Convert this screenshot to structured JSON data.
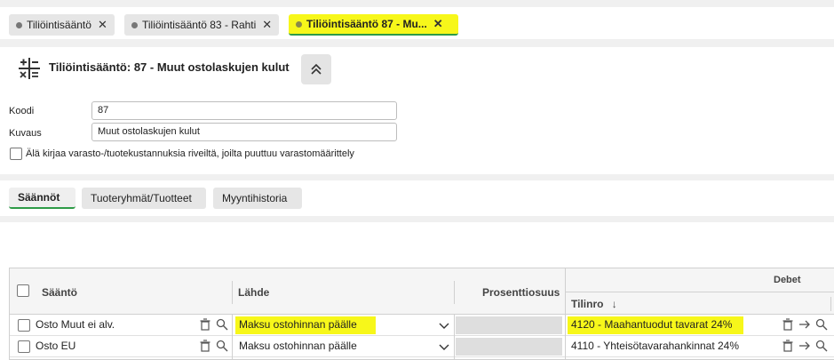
{
  "tabs": [
    {
      "label": "Tiliöintisääntö",
      "close": "✕"
    },
    {
      "label": "Tiliöintisääntö 83 - Rahti",
      "close": "✕"
    },
    {
      "label": "Tiliöintisääntö 87 - Mu...",
      "close": "✕"
    }
  ],
  "header": {
    "title": "Tiliöintisääntö: 87 - Muut ostolaskujen kulut",
    "koodi_label": "Koodi",
    "koodi_value": "87",
    "kuvaus_label": "Kuvaus",
    "kuvaus_value": "Muut ostolaskujen kulut",
    "checkbox_label": "Älä kirjaa varasto-/tuotekustannuksia riveiltä, joilta puuttuu varastomäärittely"
  },
  "subtabs": [
    "Säännöt",
    "Tuoteryhmät/Tuotteet",
    "Myyntihistoria"
  ],
  "grid": {
    "columns": {
      "saanto": "Sääntö",
      "lahde": "Lähde",
      "prosentti": "Prosenttiosuus",
      "debet": "Debet",
      "tilinro": "Tilinro",
      "sort_arrow": "↓"
    },
    "rows": [
      {
        "saanto": "Osto Muut ei alv.",
        "lahde": "Maksu ostohinnan päälle",
        "tilinro": "4120 - Maahantuodut tavarat 24%"
      },
      {
        "saanto": "Osto EU",
        "lahde": "Maksu ostohinnan päälle",
        "tilinro": "4110 - Yhteisötavarahankinnat 24%"
      }
    ]
  },
  "colors": {
    "highlight": "#f7f71a",
    "active_underline": "#2e9b47"
  }
}
